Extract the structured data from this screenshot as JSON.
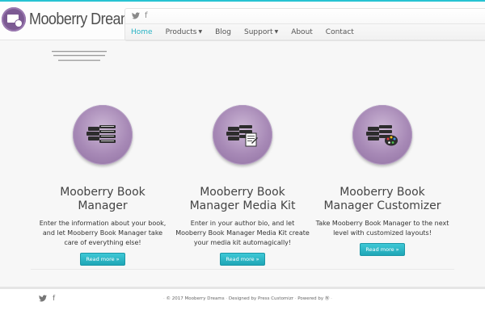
{
  "site": {
    "logo_text": "Mooberry Dreams",
    "accent_color": "#27c3d2",
    "brand_color": "#7c5a93"
  },
  "header": {
    "social": [
      {
        "icon": "twitter-icon",
        "glyph": "🐦"
      },
      {
        "icon": "facebook-icon",
        "glyph": "f"
      }
    ],
    "nav": [
      {
        "label": "Home",
        "active": true,
        "dropdown": false
      },
      {
        "label": "Products",
        "active": false,
        "dropdown": true
      },
      {
        "label": "Blog",
        "active": false,
        "dropdown": false
      },
      {
        "label": "Support",
        "active": false,
        "dropdown": true
      },
      {
        "label": "About",
        "active": false,
        "dropdown": false
      },
      {
        "label": "Contact",
        "active": false,
        "dropdown": false
      }
    ]
  },
  "features": [
    {
      "title": "Mooberry Book Manager",
      "text": "Enter the information about your book, and let Mooberry Book Manager take care of everything else!",
      "button": "Read more »",
      "icon": "books-icon"
    },
    {
      "title": "Mooberry Book Manager Media Kit",
      "text": "Enter in your author bio, and let Mooberry Book Manager Media Kit create your media kit automagically!",
      "button": "Read more »",
      "icon": "books-media-kit-icon"
    },
    {
      "title": "Mooberry Book Manager Customizer",
      "text": "Take Mooberry Book Manager to the next level with customized layouts!",
      "button": "Read more »",
      "icon": "books-palette-icon"
    }
  ],
  "footer": {
    "social": [
      {
        "icon": "twitter-icon",
        "glyph": "🐦"
      },
      {
        "icon": "facebook-icon",
        "glyph": "f"
      }
    ],
    "copyright": "© 2017 Mooberry Dreams",
    "designed_by": "Designed by Press Customizr",
    "powered_by": "Powered by",
    "wp_glyph": "Ⓦ",
    "separator": "·"
  }
}
